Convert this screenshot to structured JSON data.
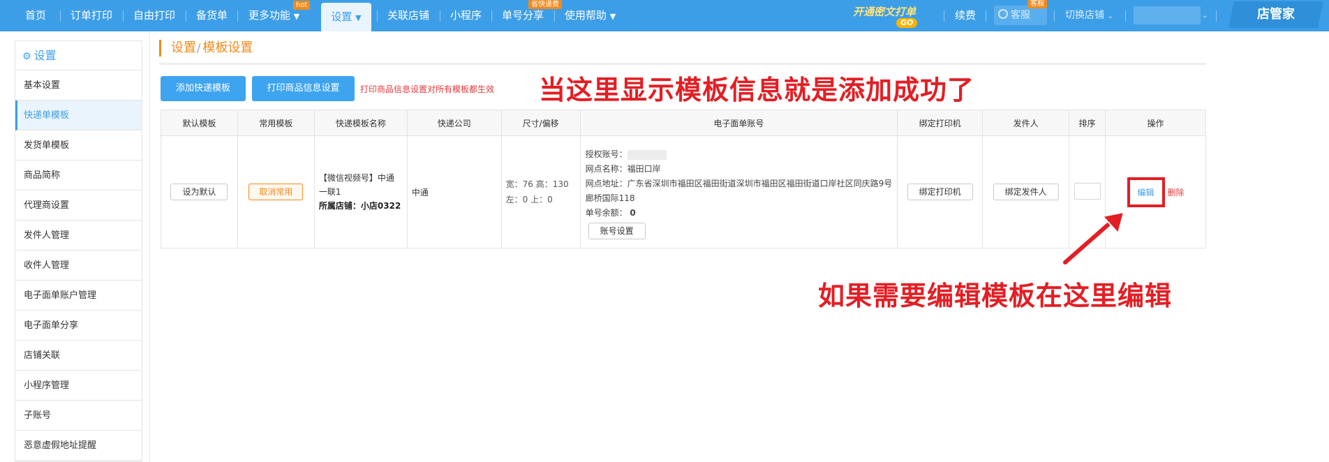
{
  "nav": {
    "items": [
      "首页",
      "订单打印",
      "自由打印",
      "备货单",
      "更多功能",
      "设置",
      "关联店铺",
      "小程序",
      "单号分享",
      "使用帮助"
    ],
    "hot_tag": "hot",
    "share_tag": "省快递费",
    "promo_text": "开通密文打单",
    "promo_go": "GO",
    "renew": "续费",
    "service": "客服",
    "service_tag": "客服",
    "switch_store": "切换店铺",
    "brand": "店管家",
    "dropdown_arrow": "▼"
  },
  "sidebar": {
    "title": "设置",
    "items": [
      "基本设置",
      "快递单模板",
      "发货单模板",
      "商品简称",
      "代理商设置",
      "发件人管理",
      "收件人管理",
      "电子面单账户管理",
      "电子面单分享",
      "店铺关联",
      "小程序管理",
      "子账号",
      "恶意虚假地址提醒"
    ]
  },
  "breadcrumb": {
    "root": "设置",
    "sep": "/",
    "current": "模板设置"
  },
  "actions": {
    "add_template": "添加快递模板",
    "print_goods_settings": "打印商品信息设置",
    "hint": "打印商品信息设置对所有模板都生效"
  },
  "annotations": {
    "top": "当这里显示模板信息就是添加成功了",
    "bottom": "如果需要编辑模板在这里编辑"
  },
  "table": {
    "headers": [
      "默认模板",
      "常用模板",
      "快递模板名称",
      "快递公司",
      "尺寸/偏移",
      "电子面单账号",
      "绑定打印机",
      "发件人",
      "排序",
      "操作"
    ],
    "row": {
      "set_default": "设为默认",
      "cancel_common": "取消常用",
      "template_name": "【微信视频号】中通一联1",
      "store_label": "所属店铺：",
      "store_name": "小店0322",
      "company": "中通",
      "size_line1": "宽：76 高：130",
      "size_line2": "左：0 上：0",
      "auth_label": "授权账号：",
      "outlet_name_label": "网点名称：",
      "outlet_name": "福田口岸",
      "outlet_addr_label": "网点地址：",
      "outlet_addr": "广东省深圳市福田区福田街道深圳市福田区福田街道口岸社区同庆路9号廊桥国际118",
      "balance_label": "单号余额：",
      "balance": "0",
      "account_settings": "账号设置",
      "bind_printer": "绑定打印机",
      "bind_sender": "绑定发件人",
      "edit": "编辑",
      "delete": "删除"
    }
  },
  "colors": {
    "nav_bg": "#3d9ee8",
    "accent_orange": "#f08a1c",
    "annotation_red": "#e31e24",
    "link_blue": "#3d9ee8"
  }
}
